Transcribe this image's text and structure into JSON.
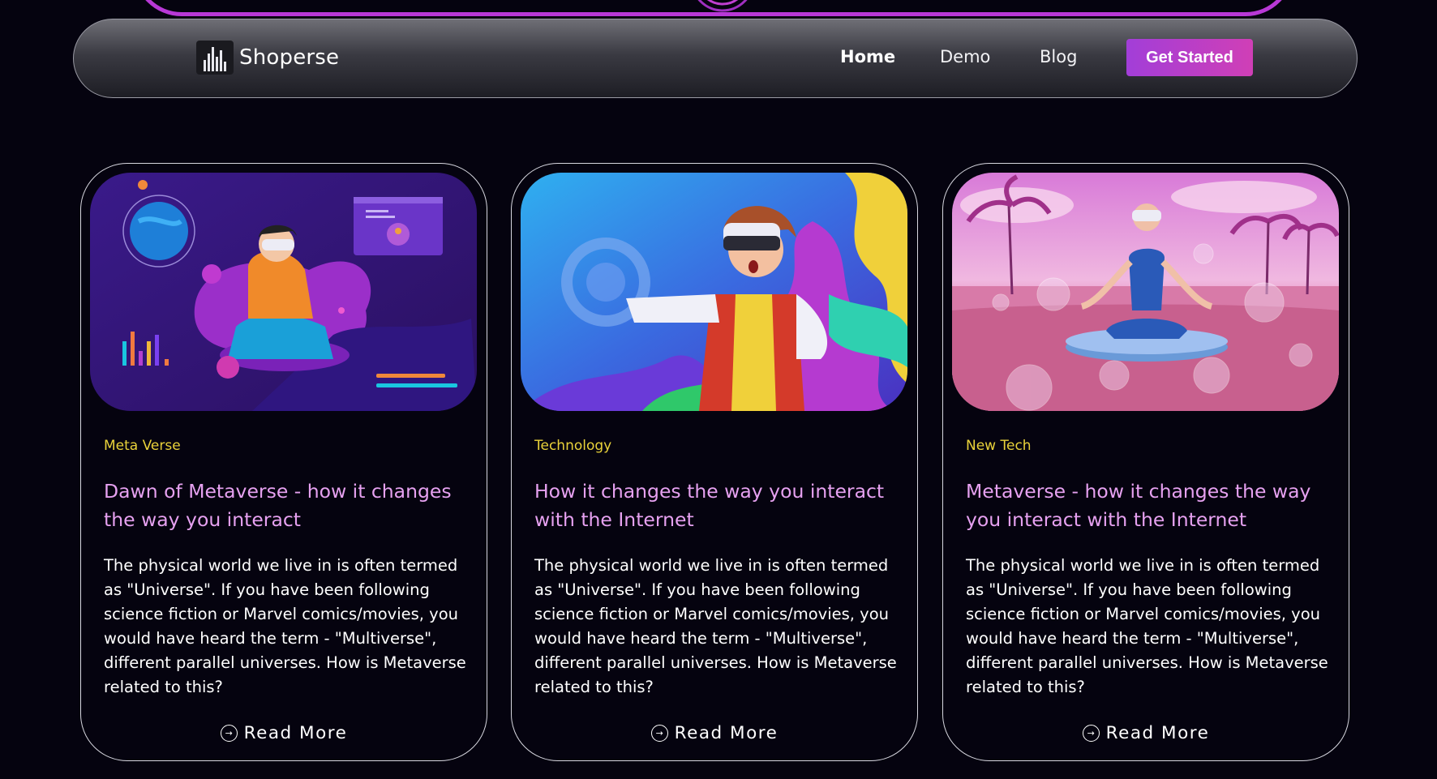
{
  "colors": {
    "background": "#05030f",
    "accent": "#c03fc8",
    "category": "#e9d23a",
    "title": "#e6a1f0"
  },
  "nav": {
    "brand_name": "Shoperse",
    "logo_icon": "building-bars-logo-icon",
    "links": [
      {
        "label": "Home",
        "active": true
      },
      {
        "label": "Demo",
        "active": false
      },
      {
        "label": "Blog",
        "active": false
      }
    ],
    "cta_label": "Get Started"
  },
  "cards": [
    {
      "image": "vr-user-with-planet-illustration",
      "category": "Meta Verse",
      "title": "Dawn of Metaverse - how it changes the way you interact",
      "body": "The physical world we live in is often termed as \"Universe\". If you have been following science fiction or Marvel comics/movies, you would have heard the term - \"Multiverse\", different parallel universes. How is Metaverse related to this?",
      "read_more": "Read More",
      "read_icon": "circle-arrow-right-icon"
    },
    {
      "image": "vr-user-colorful-waves-illustration",
      "category": "Technology",
      "title": "How it changes the way you interact with the Internet",
      "body": "The physical world we live in is often termed as \"Universe\". If you have been following science fiction or Marvel comics/movies, you would have heard the term - \"Multiverse\", different parallel universes. How is Metaverse related to this?",
      "read_more": "Read More",
      "read_icon": "circle-arrow-right-icon"
    },
    {
      "image": "vr-meditation-pink-field-photo",
      "category": "New Tech",
      "title": "Metaverse - how it changes the way you interact with the Internet",
      "body": "The physical world we live in is often termed as \"Universe\". If you have been following science fiction or Marvel comics/movies, you would have heard the term - \"Multiverse\", different parallel universes. How is Metaverse related to this?",
      "read_more": "Read More",
      "read_icon": "circle-arrow-right-icon"
    }
  ]
}
